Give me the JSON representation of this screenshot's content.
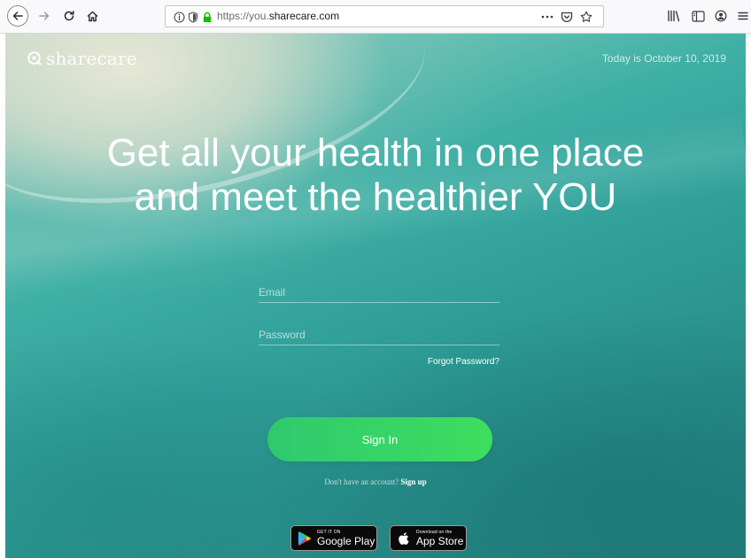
{
  "browser": {
    "url_prefix": "https://you.",
    "url_domain": "sharecare.com"
  },
  "page": {
    "brand": "sharecare",
    "date": "Today is October 10, 2019",
    "headline_line1": "Get all your health in one place",
    "headline_line2": "and meet the healthier YOU",
    "email_placeholder": "Email",
    "password_placeholder": "Password",
    "forgot_password": "Forgot Password?",
    "signin_label": "Sign In",
    "no_account_text": "Don't have an account?",
    "signup_label": "Sign up",
    "google_small": "GET IT ON",
    "google_big": "Google Play",
    "apple_small": "Download on the",
    "apple_big": "App Store"
  },
  "colors": {
    "signin_start": "#2fc96f",
    "signin_end": "#3dde5f",
    "ocean": "#2f9f98"
  },
  "icons": [
    "back-arrow-icon",
    "forward-arrow-icon",
    "reload-icon",
    "home-icon",
    "info-icon",
    "tracking-shield-icon",
    "lock-icon",
    "more-icon",
    "pocket-icon",
    "bookmark-star-icon",
    "library-icon",
    "sidebar-icon",
    "account-icon",
    "menu-icon",
    "sharecare-logo-icon",
    "google-play-icon",
    "apple-icon"
  ]
}
